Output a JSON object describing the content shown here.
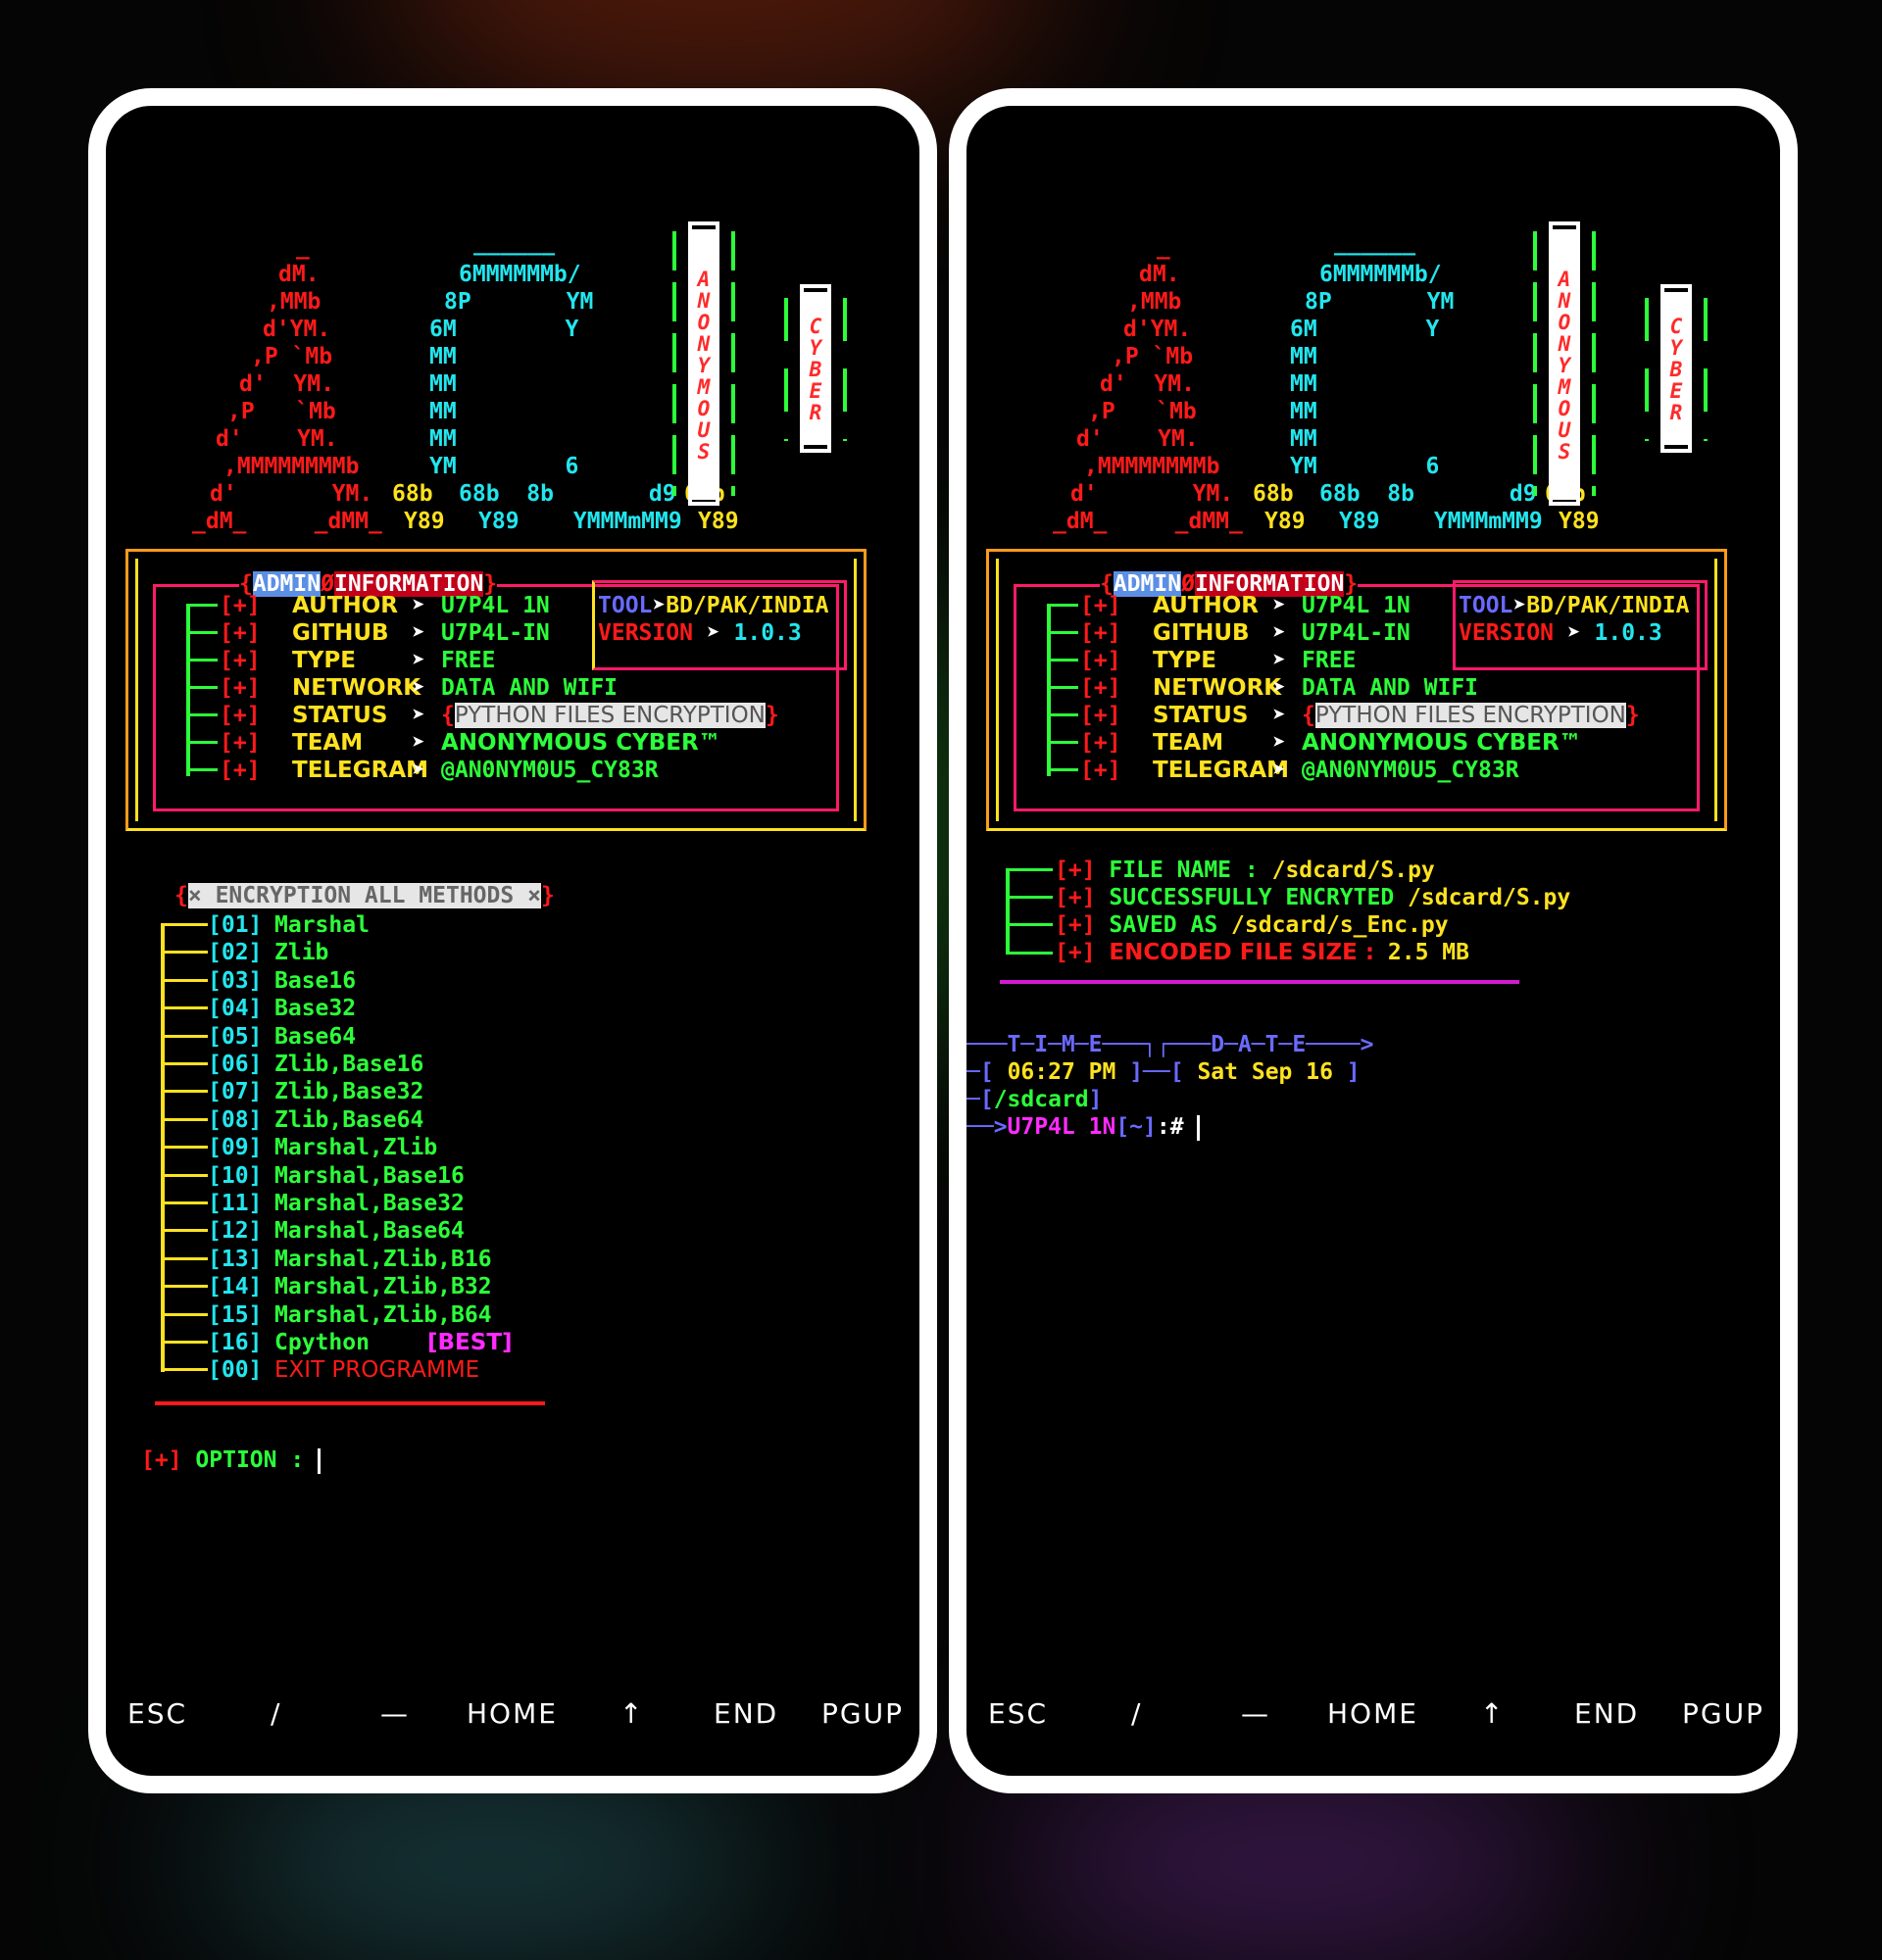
{
  "banner": {
    "ascii_a": [
      " _",
      "dM.",
      ",MMb",
      "d'YM.",
      ",P `Mb",
      "d'  YM.",
      ",P   `Mb",
      "d'    YM.",
      ",MMMMMMMMb",
      "d'       YM.",
      "_dM_     _dMM_"
    ],
    "ascii_c": [
      "______",
      "6MMMMMMb/",
      "8P       YM",
      "6M        Y",
      "MM",
      "MM",
      "MM",
      "MM",
      "YM        6",
      "68b  8b       d9",
      "Y89    YMMMmMM9"
    ],
    "ascii_i_top": "68b",
    "ascii_i_bottom": "Y89",
    "anonymous_text": "ANONYMOUS",
    "cyber_text": "CYBER"
  },
  "info": {
    "title_left": "ADMIN",
    "title_sep": "Ø",
    "title_right": "INFORMATION",
    "items": [
      {
        "prefix": "[+]",
        "key": "AUTHOR",
        "value": "U7P4L 1N"
      },
      {
        "prefix": "[+]",
        "key": "GITHUB",
        "value": "U7P4L-IN"
      },
      {
        "prefix": "[+]",
        "key": "TYPE",
        "value": "FREE"
      },
      {
        "prefix": "[+]",
        "key": "NETWORK",
        "value": "DATA AND WIFI"
      },
      {
        "prefix": "[+]",
        "key": "STATUS",
        "value": "PYTHON FILES ENCRYPTION"
      },
      {
        "prefix": "[+]",
        "key": "TEAM",
        "value": "ANONYMOUS CYBER™"
      },
      {
        "prefix": "[+]",
        "key": "TELEGRAM",
        "value": "@AN0NYM0U5_CY83R"
      }
    ],
    "arrow": "➤",
    "tool_label": "TOOL",
    "tool_value": "BD/PAK/INDIA",
    "version_label": "VERSION",
    "version_value": "1.0.3"
  },
  "menu": {
    "title": "ENCRYPTION ALL METHODS",
    "close_glyph": "×",
    "items": [
      {
        "num": "[01]",
        "label": "Marshal"
      },
      {
        "num": "[02]",
        "label": "Zlib"
      },
      {
        "num": "[03]",
        "label": "Base16"
      },
      {
        "num": "[04]",
        "label": "Base32"
      },
      {
        "num": "[05]",
        "label": "Base64"
      },
      {
        "num": "[06]",
        "label": "Zlib,Base16"
      },
      {
        "num": "[07]",
        "label": "Zlib,Base32"
      },
      {
        "num": "[08]",
        "label": "Zlib,Base64"
      },
      {
        "num": "[09]",
        "label": "Marshal,Zlib"
      },
      {
        "num": "[10]",
        "label": "Marshal,Base16"
      },
      {
        "num": "[11]",
        "label": "Marshal,Base32"
      },
      {
        "num": "[12]",
        "label": "Marshal,Base64"
      },
      {
        "num": "[13]",
        "label": "Marshal,Zlib,B16"
      },
      {
        "num": "[14]",
        "label": "Marshal,Zlib,B32"
      },
      {
        "num": "[15]",
        "label": "Marshal,Zlib,B64"
      },
      {
        "num": "[16]",
        "label": "Cpython"
      },
      {
        "num": "[00]",
        "label": "EXIT PROGRAMME"
      }
    ],
    "best_tag": "[BEST]",
    "option_prefix": "[+]",
    "option_label": "OPTION :"
  },
  "result": {
    "lines": [
      {
        "prefix": "[+]",
        "label": "FILE NAME :",
        "value": "/sdcard/S.py"
      },
      {
        "prefix": "[+]",
        "label": "SUCCESSFULLY ENCRYTED",
        "value": "/sdcard/S.py"
      },
      {
        "prefix": "[+]",
        "label": "SAVED AS",
        "value": "/sdcard/s_Enc.py"
      },
      {
        "prefix": "[+]",
        "label": "ENCODED FILE SIZE :",
        "value": "2.5 MB"
      }
    ]
  },
  "prompt": {
    "header_line": "───T─I─M─E───┐┌───D─A─T─E────>",
    "time_open": "─[",
    "time": "06:27 PM",
    "time_mid": "]──[",
    "date": "Sat Sep 16",
    "date_close": "]",
    "dir_open": "─[",
    "dir": "/sdcard",
    "dir_close": "]",
    "prompt_arrow": "──>",
    "user": "U7P4L 1N",
    "path": "[~]",
    "symbol": ":#"
  },
  "keyboard": {
    "keys": [
      "ESC",
      "/",
      "—",
      "HOME",
      "↑",
      "END",
      "PGUP"
    ]
  }
}
